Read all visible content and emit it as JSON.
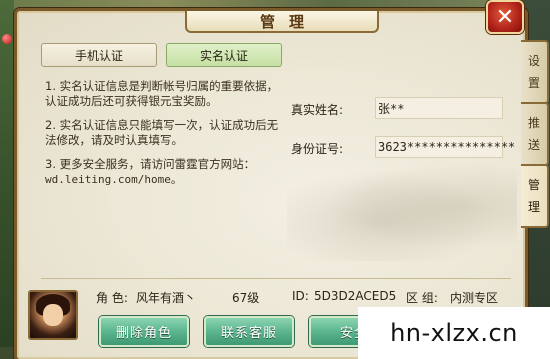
{
  "window": {
    "title": "管理",
    "close_label": "✕"
  },
  "tabs": [
    {
      "label": "手机认证",
      "active": false
    },
    {
      "label": "实名认证",
      "active": true
    }
  ],
  "side_tabs": [
    {
      "label": "设置"
    },
    {
      "label": "推送"
    },
    {
      "label": "管理",
      "active": true
    }
  ],
  "info": {
    "item1": "1. 实名认证信息是判断帐号归属的重要依据，认证成功后还可获得银元宝奖励。",
    "item2": "2. 实名认证信息只能填写一次，认证成功后无法修改，请及时认真填写。",
    "item3_prefix": "3. 更多安全服务，请访问雷霆官方网站：",
    "item3_url": "wd.leiting.com/home。"
  },
  "form": {
    "name_label": "真实姓名:",
    "name_value": "张**",
    "id_label": "身份证号:",
    "id_value": "3623***************"
  },
  "character": {
    "role_label": "角 色:",
    "role_value": "风年有酒丶",
    "level": "67级",
    "id_label": "ID:",
    "id_value": "5D3D2ACED5",
    "server_label": "区 组:",
    "server_value": "内测专区"
  },
  "buttons": {
    "delete_role": "删除角色",
    "contact_support": "联系客服",
    "security": "安全"
  },
  "watermark": "hn-xlzx.cn",
  "colors": {
    "panel_border": "#7a5a2a",
    "button_green": "#5bb58e",
    "tab_active": "#c6e0a4",
    "close_red": "#b0221a"
  }
}
